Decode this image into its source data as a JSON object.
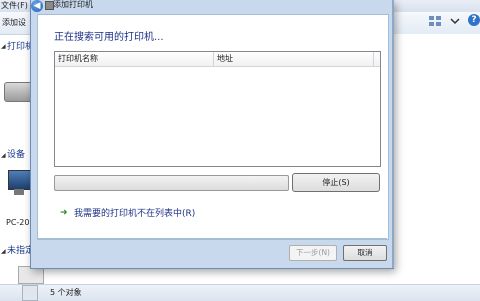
{
  "background": {
    "menu_label": "文件(F)",
    "toolbar_label": "添加设",
    "sections": [
      {
        "label": "打印机"
      },
      {
        "label": "设备"
      },
      {
        "label": "未指定"
      }
    ],
    "device_label": "PC-20",
    "status_text": "5 个对象",
    "help_glyph": "?"
  },
  "dialog": {
    "title": "添加打印机",
    "back_glyph": "◀",
    "heading": "正在搜索可用的打印机...",
    "columns": [
      "打印机名称",
      "地址"
    ],
    "stop_label": "停止(S)",
    "link_label": "我需要的打印机不在列表中(R)",
    "link_arrow": "➜",
    "next_label": "下一步(N)",
    "cancel_label": "取消"
  },
  "colors": {
    "dialog_frame": "#c8d9ee",
    "heading_text": "#1e3287",
    "link_text": "#1e3287"
  }
}
